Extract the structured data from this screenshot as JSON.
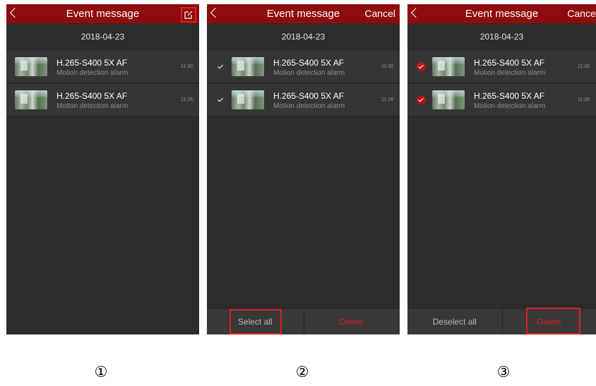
{
  "screens": [
    {
      "title": "Event message",
      "date": "2018-04-23",
      "items": [
        {
          "device": "H.265-S400 5X AF",
          "event": "Motion detection alarm",
          "time": "11:30"
        },
        {
          "device": "H.265-S400 5X AF",
          "event": "Motion detection alarm",
          "time": "11:28"
        }
      ],
      "caption": "①"
    },
    {
      "title": "Event message",
      "cancel": "Cancel",
      "date": "2018-04-23",
      "items": [
        {
          "device": "H.265-S400 5X AF",
          "event": "Motion detection alarm",
          "time": "11:30",
          "checked": false
        },
        {
          "device": "H.265-S400 5X AF",
          "event": "Motion detection alarm",
          "time": "11:28",
          "checked": false
        }
      ],
      "left_action": "Select all",
      "right_action": "Delete",
      "caption": "②"
    },
    {
      "title": "Event message",
      "cancel": "Cancel",
      "date": "2018-04-23",
      "items": [
        {
          "device": "H.265-S400 5X AF",
          "event": "Motion detection alarm",
          "time": "11:30",
          "checked": true
        },
        {
          "device": "H.265-S400 5X AF",
          "event": "Motion detection alarm",
          "time": "11:28",
          "checked": true
        }
      ],
      "left_action": "Deselect all",
      "right_action": "Delete",
      "caption": "③"
    }
  ],
  "icons": {
    "back": "chevron-left-icon",
    "edit": "edit-icon",
    "check": "checkmark-icon"
  },
  "colors": {
    "header": "#8f0c0c",
    "background": "#2c2c2c",
    "row": "#353535",
    "highlight": "#e0201e",
    "delete": "#d61d1d",
    "checked": "#b41616"
  }
}
